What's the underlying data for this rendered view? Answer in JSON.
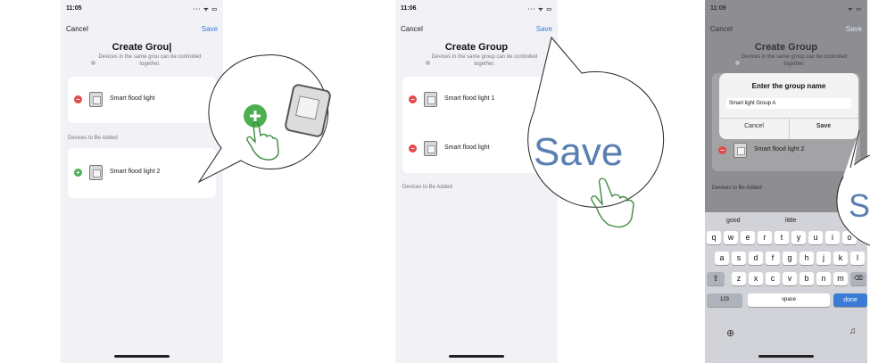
{
  "screen1": {
    "status_time": "11:05",
    "status_icons": "··· ᯤ ▭",
    "cancel": "Cancel",
    "save": "Save",
    "title": "Create Grou|",
    "subtitle": "Devices in the same grou can be controlled together.",
    "group_item": "Smart flood light",
    "section_label": "Devices to Be Added",
    "add_item": "Smart flood light 2"
  },
  "screen2": {
    "status_time": "11:06",
    "status_icons": "··· ᯤ ▭",
    "cancel": "Cancel",
    "save": "Save",
    "title": "Create Group",
    "subtitle": "Devices in the same group can be controlled together.",
    "items": [
      "Smart flood light 1",
      "Smart flood light"
    ],
    "section_label": "Devices to Be Added",
    "callout_text": "Save"
  },
  "screen3": {
    "status_time": "11:09",
    "status_icons": "ᯤ ▭",
    "cancel": "Cancel",
    "save": "Save",
    "title": "Create Group",
    "subtitle": "Devices in the same group can be controlled together.",
    "dialog": {
      "title": "Enter the group name",
      "input_value": "Smart light Group A",
      "cancel": "Cancel",
      "save": "Save"
    },
    "behind_item": "Smart flood light 2",
    "section_label": "Devices to Be Added",
    "suggestions": [
      "good",
      "little"
    ],
    "row1": [
      "q",
      "w",
      "e",
      "r",
      "t",
      "y",
      "u",
      "i",
      "o"
    ],
    "row2": [
      "a",
      "s",
      "d",
      "f",
      "g",
      "h",
      "j",
      "k",
      "l"
    ],
    "row3": [
      "z",
      "x",
      "c",
      "v",
      "b",
      "n",
      "m"
    ],
    "key_123": "123",
    "key_space": "space",
    "key_done": "done",
    "callout_letter": "S"
  }
}
